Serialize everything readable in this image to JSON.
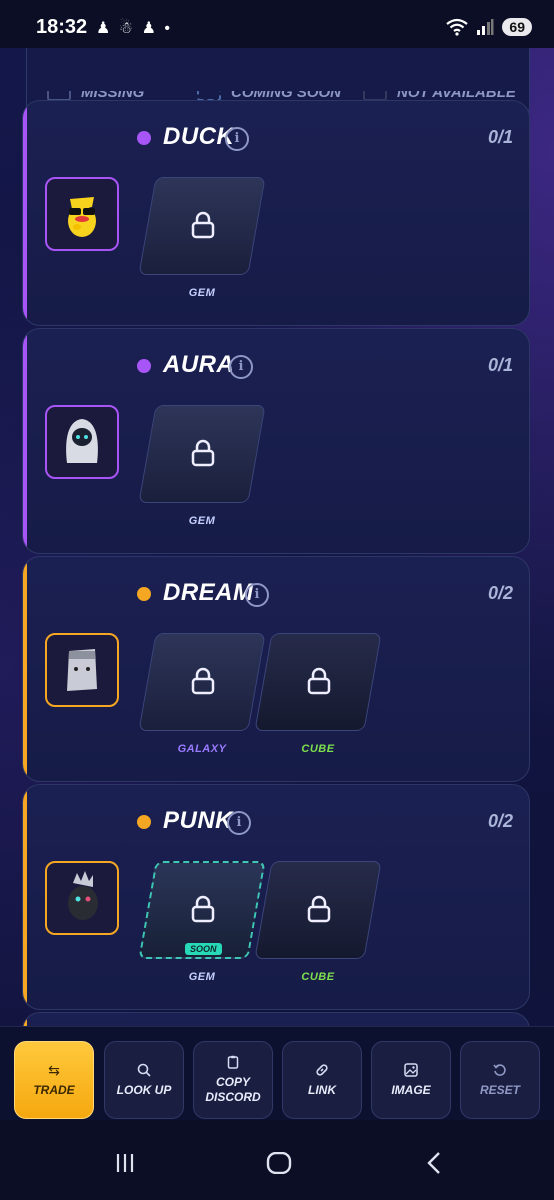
{
  "status_bar": {
    "time": "18:32",
    "notification_icons": "♟ ☃ ♟ •",
    "battery": "69"
  },
  "legend": {
    "items": [
      {
        "label": "MISSING"
      },
      {
        "label": "COMING SOON"
      },
      {
        "label": "NOT AVAILABLE"
      }
    ]
  },
  "cards": [
    {
      "name": "DUCK",
      "count": "0/1",
      "rarity_color": "#a855f7",
      "variants": [
        {
          "label": "GEM",
          "color": "#c6d0ff",
          "soon": false
        }
      ]
    },
    {
      "name": "AURA",
      "count": "0/1",
      "rarity_color": "#a855f7",
      "variants": [
        {
          "label": "GEM",
          "color": "#c6d0ff",
          "soon": false
        }
      ]
    },
    {
      "name": "DREAM",
      "count": "0/2",
      "rarity_color": "#f5a623",
      "variants": [
        {
          "label": "GALAXY",
          "color": "#9b7bff",
          "soon": false
        },
        {
          "label": "CUBE",
          "color": "#7ee04c",
          "soon": false
        }
      ]
    },
    {
      "name": "PUNK",
      "count": "0/2",
      "rarity_color": "#f5a623",
      "variants": [
        {
          "label": "GEM",
          "color": "#c6d0ff",
          "soon": true,
          "badge": "SOON"
        },
        {
          "label": "CUBE",
          "color": "#7ee04c",
          "soon": false
        }
      ]
    }
  ],
  "actions": [
    {
      "label": "TRADE",
      "icon": "swap-arrows-icon",
      "primary": true
    },
    {
      "label": "LOOK UP",
      "icon": "search-icon",
      "primary": false
    },
    {
      "label": "COPY\nDISCORD",
      "icon": "clipboard-icon",
      "primary": false
    },
    {
      "label": "LINK",
      "icon": "link-icon",
      "primary": false
    },
    {
      "label": "IMAGE",
      "icon": "image-icon",
      "primary": false
    },
    {
      "label": "RESET",
      "icon": "reset-icon",
      "primary": false
    }
  ]
}
